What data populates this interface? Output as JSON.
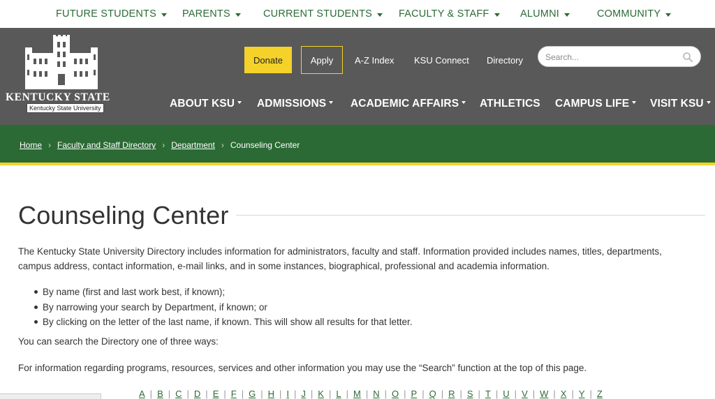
{
  "audience_nav": [
    {
      "label": "FUTURE STUDENTS"
    },
    {
      "label": "PARENTS"
    },
    {
      "label": "CURRENT STUDENTS"
    },
    {
      "label": "FACULTY & STAFF"
    },
    {
      "label": "ALUMNI"
    },
    {
      "label": "COMMUNITY"
    }
  ],
  "logo": {
    "wordmark": "KENTUCKY STATE",
    "subtitle": "Kentucky State University"
  },
  "utility": {
    "donate": "Donate",
    "apply": "Apply",
    "az_index": "A-Z Index",
    "ksu_connect": "KSU Connect",
    "directory": "Directory"
  },
  "search": {
    "placeholder": "Search..."
  },
  "main_nav": [
    {
      "label": "ABOUT KSU",
      "dropdown": true
    },
    {
      "label": "ADMISSIONS",
      "dropdown": true
    },
    {
      "label": "ACADEMIC AFFAIRS",
      "dropdown": true
    },
    {
      "label": "ATHLETICS",
      "dropdown": false
    },
    {
      "label": "CAMPUS LIFE",
      "dropdown": true
    },
    {
      "label": "VISIT KSU",
      "dropdown": true
    }
  ],
  "breadcrumb": {
    "items": [
      "Home",
      "Faculty and Staff Directory",
      "Department"
    ],
    "current": "Counseling Center"
  },
  "content": {
    "title": "Counseling Center",
    "intro": "The Kentucky State University Directory includes information for administrators, faculty and staff. Information provided includes names, titles, departments, campus address, contact information, e-mail links, and in some instances, biographical, professional and academia information.",
    "ways": [
      "By name (first and last work best, if known);",
      "By narrowing your search by Department, if known; or",
      "By clicking on the letter of the last name, if known. This will show all results for that letter."
    ],
    "search_ways": "You can search the Directory one of three ways:",
    "info": "For information regarding programs, resources, services and other information you may use the “Search” function at the top of this page."
  },
  "alphabet": [
    "A",
    "B",
    "C",
    "D",
    "E",
    "F",
    "G",
    "H",
    "I",
    "J",
    "K",
    "L",
    "M",
    "N",
    "O",
    "P",
    "Q",
    "R",
    "S",
    "T",
    "U",
    "V",
    "W",
    "X",
    "Y",
    "Z"
  ],
  "colors": {
    "brand_green": "#2c6a35",
    "header_gray": "#595959",
    "accent_yellow": "#f4d229"
  }
}
